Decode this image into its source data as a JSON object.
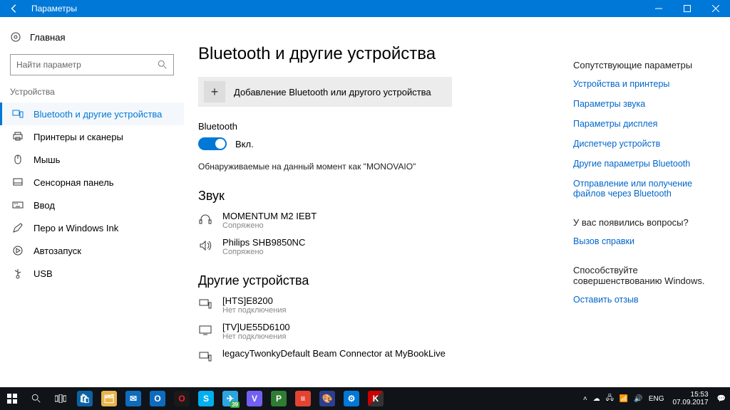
{
  "titlebar": {
    "title": "Параметры"
  },
  "sidebar": {
    "home": "Главная",
    "search_placeholder": "Найти параметр",
    "group": "Устройства",
    "items": [
      {
        "label": "Bluetooth и другие устройства",
        "active": true
      },
      {
        "label": "Принтеры и сканеры"
      },
      {
        "label": "Мышь"
      },
      {
        "label": "Сенсорная панель"
      },
      {
        "label": "Ввод"
      },
      {
        "label": "Перо и Windows Ink"
      },
      {
        "label": "Автозапуск"
      },
      {
        "label": "USB"
      }
    ]
  },
  "main": {
    "title": "Bluetooth и другие устройства",
    "add_device": "Добавление Bluetooth или другого устройства",
    "bt_label": "Bluetooth",
    "bt_on": "Вкл.",
    "discoverable": "Обнаруживаемые на данный момент как \"MONOVAIO\"",
    "audio_header": "Звук",
    "audio": [
      {
        "name": "MOMENTUM M2 IEBT",
        "status": "Сопряжено"
      },
      {
        "name": "Philips SHB9850NC",
        "status": "Сопряжено"
      }
    ],
    "other_header": "Другие устройства",
    "other": [
      {
        "name": "[HTS]E8200",
        "status": "Нет подключения"
      },
      {
        "name": "[TV]UE55D6100",
        "status": "Нет подключения"
      },
      {
        "name": "legacyTwonkyDefault Beam Connector at MyBookLive",
        "status": ""
      }
    ]
  },
  "right": {
    "related_header": "Сопутствующие параметры",
    "links": [
      "Устройства и принтеры",
      "Параметры звука",
      "Параметры дисплея",
      "Диспетчер устройств",
      "Другие параметры Bluetooth",
      "Отправление или получение файлов через Bluetooth"
    ],
    "q_header": "У вас появились вопросы?",
    "help_link": "Вызов справки",
    "improve_header": "Способствуйте совершенствованию Windows.",
    "feedback_link": "Оставить отзыв"
  },
  "taskbar": {
    "lang": "ENG",
    "time": "15:53",
    "date": "07.09.2017",
    "badge": "39"
  }
}
